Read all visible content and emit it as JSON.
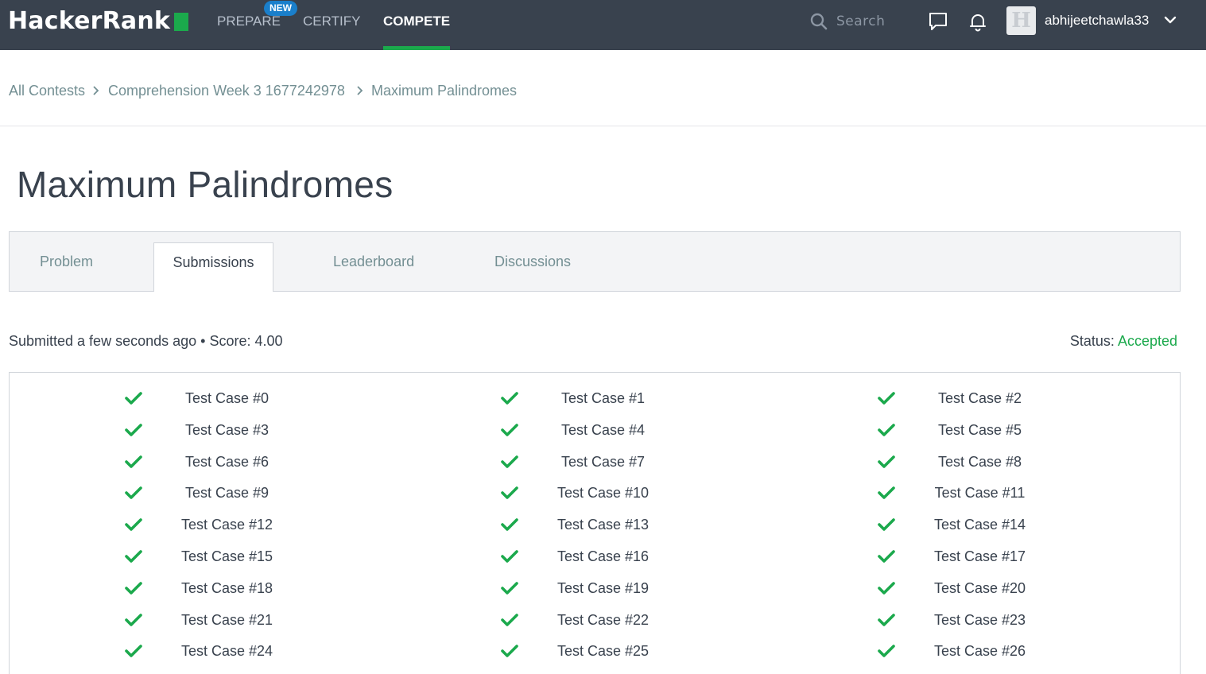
{
  "header": {
    "logo": "HackerRank",
    "nav": [
      {
        "label": "PREPARE",
        "badge": "NEW"
      },
      {
        "label": "CERTIFY"
      },
      {
        "label": "COMPETE",
        "active": true
      }
    ],
    "search_placeholder": "Search",
    "avatar_letter": "H",
    "username": "abhijeetchawla33"
  },
  "breadcrumb": [
    "All Contests",
    "Comprehension Week 3 1677242978",
    "Maximum Palindromes"
  ],
  "page_title": "Maximum Palindromes",
  "tabs": [
    "Problem",
    "Submissions",
    "Leaderboard",
    "Discussions"
  ],
  "active_tab": "Submissions",
  "submission": {
    "info": "Submitted a few seconds ago • Score: 4.00",
    "status_label": "Status:",
    "status_value": "Accepted"
  },
  "colors": {
    "accent": "#1ba94c",
    "header_bg": "#39424e",
    "badge": "#1a7fcb"
  },
  "test_cases": {
    "col0": [
      "Test Case #0",
      "Test Case #3",
      "Test Case #6",
      "Test Case #9",
      "Test Case #12",
      "Test Case #15",
      "Test Case #18",
      "Test Case #21",
      "Test Case #24"
    ],
    "col1": [
      "Test Case #1",
      "Test Case #4",
      "Test Case #7",
      "Test Case #10",
      "Test Case #13",
      "Test Case #16",
      "Test Case #19",
      "Test Case #22",
      "Test Case #25"
    ],
    "col2": [
      "Test Case #2",
      "Test Case #5",
      "Test Case #8",
      "Test Case #11",
      "Test Case #14",
      "Test Case #17",
      "Test Case #20",
      "Test Case #23",
      "Test Case #26"
    ],
    "status_icon": "check-icon"
  }
}
